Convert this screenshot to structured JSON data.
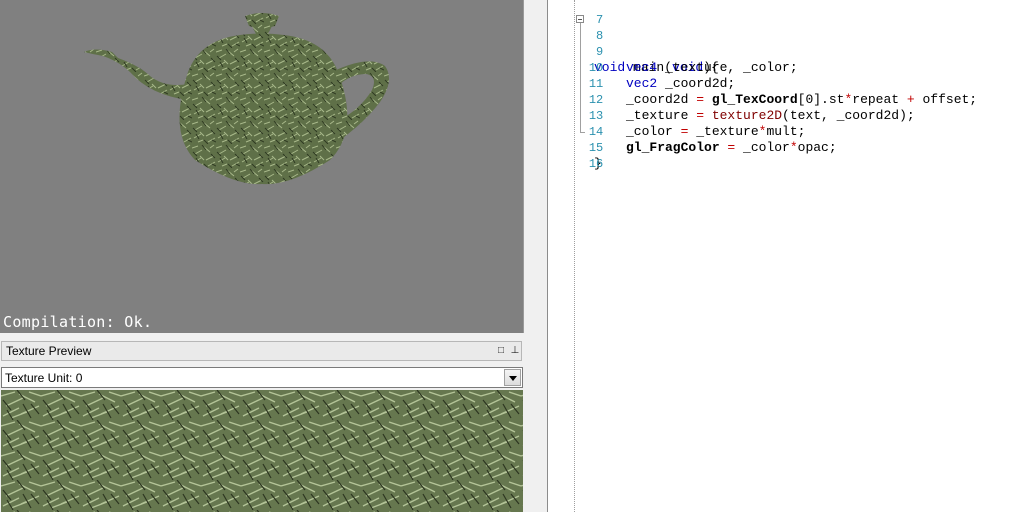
{
  "viewport": {
    "compilation_status": "Compilation: Ok."
  },
  "texture_panel": {
    "title": "Texture Preview",
    "unit_select_value": "Texture Unit: 0"
  },
  "editor": {
    "line_numbers": [
      "7",
      "8",
      "9",
      "10",
      "11",
      "12",
      "13",
      "14",
      "15",
      "16"
    ],
    "code": {
      "l8_void": "void",
      "l8_main": " main(",
      "l8_void2": "void",
      "l8_end": "){",
      "l9_type": "vec4",
      "l9_rest": " _texture, _color;",
      "l10_type": "vec2",
      "l10_rest": " _coord2d;",
      "l11_a": "_coord2d ",
      "l11_eq": "=",
      "l11_b": " gl_TexCoord",
      "l11_c": "[0].st",
      "l11_mul": "*",
      "l11_d": "repeat ",
      "l11_plus": "+",
      "l11_e": " offset;",
      "l12_a": "_texture ",
      "l12_eq": "=",
      "l12_fn": " texture2D",
      "l12_rest": "(text, _coord2d);",
      "l13_a": "_color ",
      "l13_eq": "=",
      "l13_b": " _texture",
      "l13_mul": "*",
      "l13_c": "mult;",
      "l14_a": "gl_FragColor",
      "l14_eq": " =",
      "l14_b": " _color",
      "l14_mul": "*",
      "l14_c": "opac;",
      "l15": "}"
    }
  },
  "colors": {
    "viewport_bg": "#808080",
    "keyword": "#0000c0",
    "function": "#800000",
    "operator": "#c00000",
    "line_number": "#2b91af",
    "grass": "#5f7048"
  }
}
